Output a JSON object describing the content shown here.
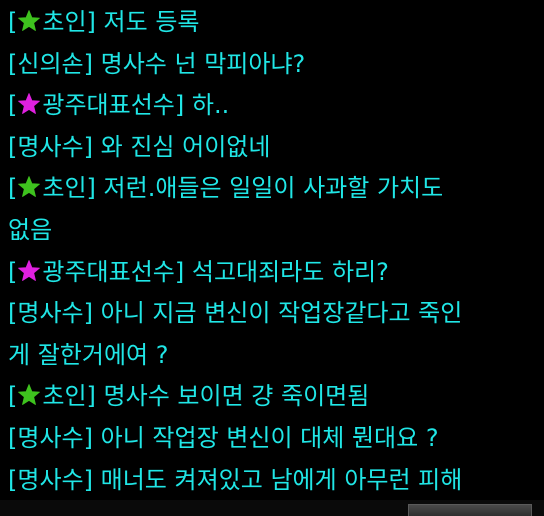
{
  "colors": {
    "text": "#20e6e6",
    "background": "#000000",
    "star_green": "#3ec21e",
    "star_magenta": "#e020e0"
  },
  "chat": {
    "lines": [
      {
        "open": "[",
        "icon": "green-star",
        "name": "초인",
        "close": "]",
        "text": " 저도 등록"
      },
      {
        "open": "[",
        "icon": "",
        "name": "신의손",
        "close": "]",
        "text": " 명사수 넌 막피아냐?"
      },
      {
        "open": "[",
        "icon": "magenta-star",
        "name": "광주대표선수",
        "close": "]",
        "text": " 하.."
      },
      {
        "open": "[",
        "icon": "",
        "name": "명사수",
        "close": "]",
        "text": " 와 진심 어이없네"
      },
      {
        "open": "[",
        "icon": "green-star",
        "name": "초인",
        "close": "]",
        "text": " 저런.애들은 일일이 사과할 가치도"
      },
      {
        "continuation": "없음"
      },
      {
        "open": "[",
        "icon": "magenta-star",
        "name": "광주대표선수",
        "close": "]",
        "text": " 석고대죄라도 하리?"
      },
      {
        "open": "[",
        "icon": "",
        "name": "명사수",
        "close": "]",
        "text": " 아니 지금 변신이 작업장같다고 죽인"
      },
      {
        "continuation": "게 잘한거에여 ?"
      },
      {
        "open": "[",
        "icon": "green-star",
        "name": "초인",
        "close": "]",
        "text": " 명사수 보이면 걍 죽이면됨"
      },
      {
        "open": "[",
        "icon": "",
        "name": "명사수",
        "close": "]",
        "text": " 아니 작업장 변신이 대체 뭔대요 ?"
      },
      {
        "open": "[",
        "icon": "",
        "name": "명사수",
        "close": "]",
        "text": " 매너도 켜져있고 남에게 아무런 피해"
      }
    ]
  }
}
